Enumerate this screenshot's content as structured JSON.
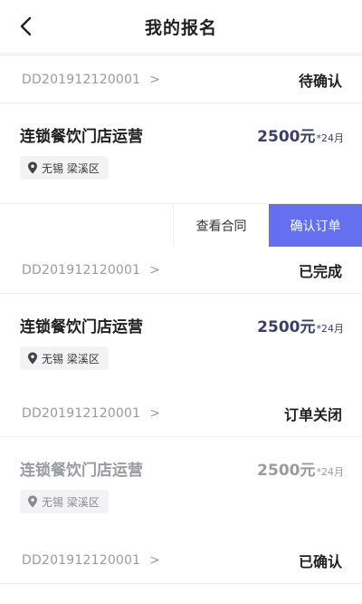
{
  "header": {
    "title": "我的报名",
    "back_icon": "chevron-left-icon"
  },
  "orders": [
    {
      "order_no": "DD201912120001",
      "chevron": ">",
      "status": "待确认",
      "job_title": "连锁餐饮门店运营",
      "salary": "2500元",
      "period": "*24月",
      "location": "无锡 梁溪区",
      "actions": {
        "contract": "查看合同",
        "confirm": "确认订单"
      }
    },
    {
      "order_no": "DD201912120001",
      "chevron": ">",
      "status": "已完成",
      "job_title": "连锁餐饮门店运营",
      "salary": "2500元",
      "period": "*24月",
      "location": "无锡 梁溪区"
    },
    {
      "order_no": "DD201912120001",
      "chevron": ">",
      "status": "订单关闭",
      "job_title": "连锁餐饮门店运营",
      "salary": "2500元",
      "period": "*24月",
      "location": "无锡 梁溪区"
    },
    {
      "order_no": "DD201912120001",
      "chevron": ">",
      "status": "已确认"
    }
  ],
  "colors": {
    "accent": "#6570f0",
    "salary": "#3a3f6a",
    "muted": "#9a9aa2",
    "background": "#f4f4f6"
  }
}
